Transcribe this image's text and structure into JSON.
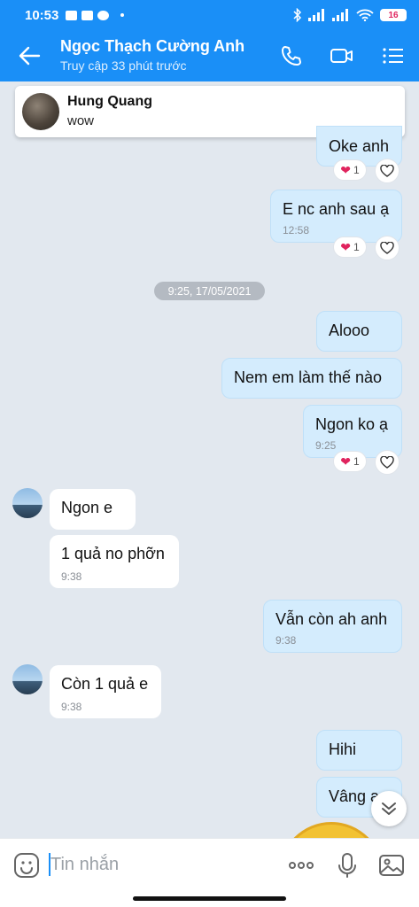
{
  "status_bar": {
    "time": "10:53",
    "battery": "16"
  },
  "header": {
    "title": "Ngọc Thạch Cường Anh",
    "subtitle": "Truy cập 33 phút trước"
  },
  "pinned": {
    "name": "Hung Quang",
    "message": "wow"
  },
  "date_separator": "9:25, 17/05/2021",
  "messages": [
    {
      "text": "Oke anh",
      "reaction_count": "1"
    },
    {
      "text": "E nc anh sau ạ",
      "time": "12:58",
      "reaction_count": "1"
    },
    {
      "text": "Alooo"
    },
    {
      "text": "Nem em làm thế nào"
    },
    {
      "text": "Ngon ko ạ",
      "time": "9:25",
      "reaction_count": "1"
    },
    {
      "text": "Ngon e"
    },
    {
      "text": "1 quả no phỡn",
      "time": "9:38"
    },
    {
      "text": "Vẫn còn ah anh",
      "time": "9:38"
    },
    {
      "text": "Còn 1 quả e",
      "time": "9:38"
    },
    {
      "text": "Hihi"
    },
    {
      "text": "Vâng ạ"
    }
  ],
  "input": {
    "placeholder": "Tin nhắn"
  },
  "colors": {
    "primary": "#1a8ff7",
    "bubble_out": "#d4ecfd",
    "bubble_in": "#ffffff",
    "background": "#e2e8ef",
    "heart": "#e0245e"
  }
}
